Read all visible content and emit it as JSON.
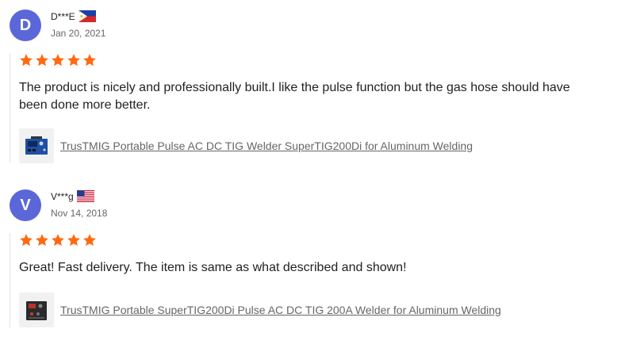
{
  "reviews": [
    {
      "avatar_letter": "D",
      "name": "D***E",
      "country_flag": "philippines-flag-icon",
      "date": "Jan 20, 2021",
      "rating": 5,
      "text": "The product is nicely and professionally built.I like the pulse function but the gas hose should have been done more better.",
      "product_title": "TrusTMIG Portable Pulse AC DC TIG Welder SuperTIG200Di for Aluminum Welding",
      "product_thumb": "blue-welder-thumbnail"
    },
    {
      "avatar_letter": "V",
      "name": "V***g",
      "country_flag": "usa-flag-icon",
      "date": "Nov 14, 2018",
      "rating": 5,
      "text": "Great! Fast delivery. The item is same as what described and shown!",
      "product_title": "TrusTMIG Portable SuperTIG200Di Pulse AC DC TIG 200A Welder for Aluminum Welding",
      "product_thumb": "black-welder-thumbnail"
    }
  ],
  "colors": {
    "avatar_bg": "#5b67d8",
    "star": "#ff6a13",
    "link": "#666666",
    "divider": "#e3e3e3"
  }
}
